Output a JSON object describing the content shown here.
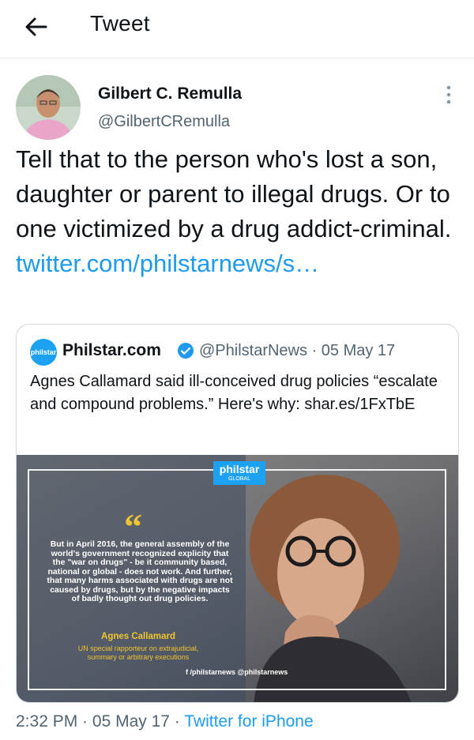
{
  "header": {
    "title": "Tweet"
  },
  "tweet": {
    "author_name": "Gilbert C. Remulla",
    "author_handle": "@GilbertCRemulla",
    "text": "Tell that to the person who's lost a son, daughter or parent to illegal drugs. Or to one victimized by a drug addict-criminal. ",
    "link": "twitter.com/philstarnews/s…",
    "time": "2:32 PM",
    "separator": " · ",
    "date": "05 May 17",
    "source": "Twitter for iPhone"
  },
  "quote": {
    "logo_text": "philstar",
    "name": "Philstar.com",
    "handle_date": "@PhilstarNews · 05 May 17",
    "text": "Agnes Callamard said ill-conceived drug policies “escalate and compound problems.” Here's why: shar.es/1FxTbE",
    "card": {
      "brand": "philstar",
      "brand_sub": "GLOBAL",
      "quote_mark": "“",
      "quote": "But in April 2016, the general assembly of the world's government recognized explicity that the \"war on drugs\" - be it community based, national or global - does not work. And further, that many harms associated with drugs are not caused by drugs, but by the negative impacts of badly thought out drug policies.",
      "author": "Agnes Callamard",
      "role": "UN special rapporteur on extrajudicial, summary or arbitrary executions",
      "social": "f /philstarnews   @philstarnews"
    }
  },
  "icons": [
    "back-arrow-icon",
    "more-vertical-icon",
    "verified-badge-icon"
  ],
  "colors": {
    "link": "#1d9bf0",
    "secondary": "#536471",
    "accent": "#f0c330"
  }
}
